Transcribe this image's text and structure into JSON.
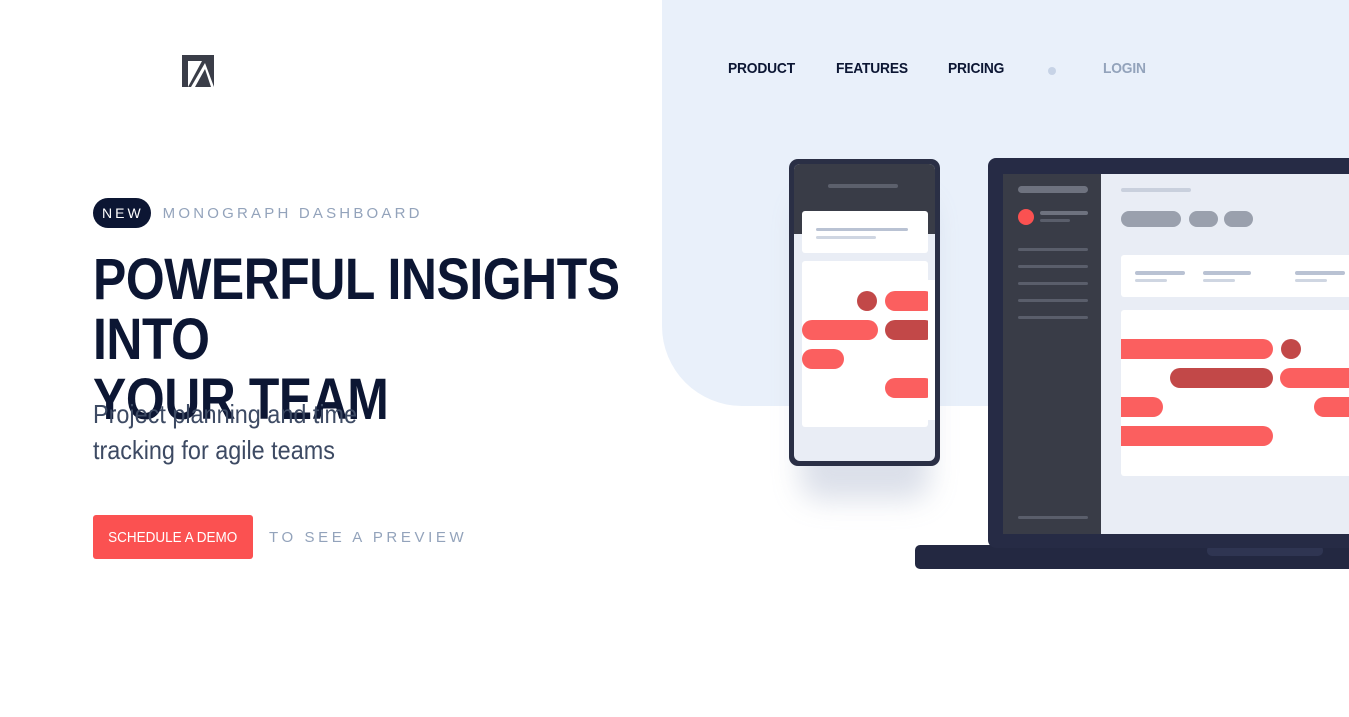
{
  "brand": {
    "logo_icon": "monograph-logo-icon"
  },
  "nav": {
    "items": [
      {
        "label": "PRODUCT"
      },
      {
        "label": "FEATURES"
      },
      {
        "label": "PRICING"
      }
    ],
    "login_label": "LOGIN"
  },
  "hero": {
    "badge": "NEW",
    "eyebrow": "MONOGRAPH DASHBOARD",
    "headline_line1": "POWERFUL INSIGHTS INTO",
    "headline_line2": "YOUR TEAM",
    "subhead_line1": "Project planning and time",
    "subhead_line2": "tracking for agile teams",
    "cta_label": "SCHEDULE A DEMO",
    "cta_note": "TO SEE A PREVIEW"
  },
  "colors": {
    "navy": "#0c1633",
    "accent": "#fb5151",
    "accent_dark": "#c24848",
    "muted": "#93a3bb",
    "panel_bg": "#e9f0fa"
  }
}
